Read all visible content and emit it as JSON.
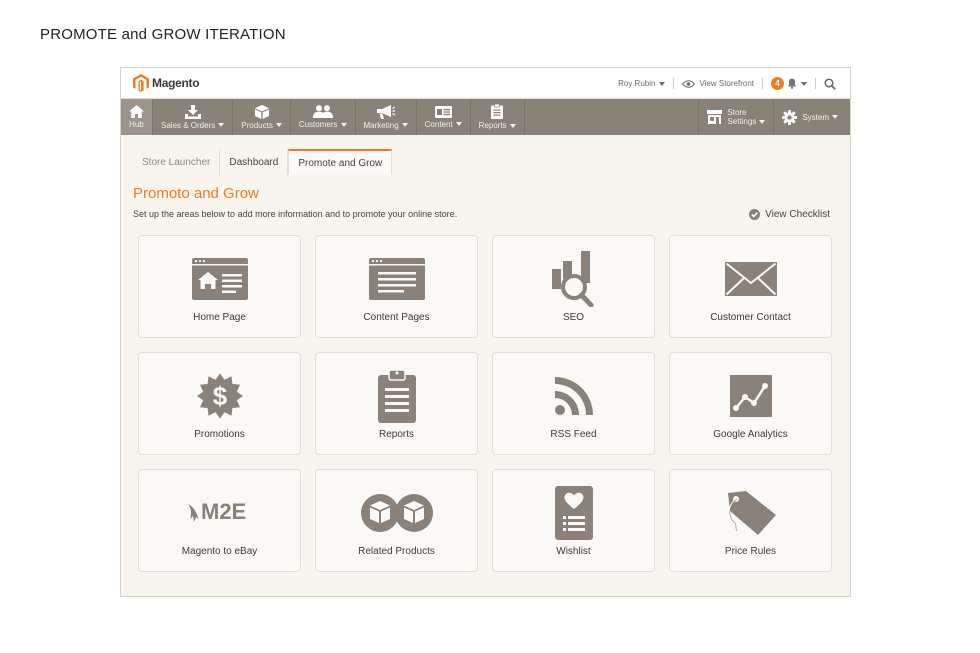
{
  "caption": "PROMOTE and GROW ITERATION",
  "brand": {
    "logo_text": "Magento",
    "accent": "#ef7c22",
    "nav_bg": "#8a8279",
    "icon_color": "#8a8279"
  },
  "topbar": {
    "user": "Roy Rubin",
    "storefront": "View Storefront",
    "notifications": "4"
  },
  "nav": {
    "items": [
      {
        "label": "Hub",
        "icon": "home-icon"
      },
      {
        "label": "Sales & Orders",
        "icon": "download-tray-icon"
      },
      {
        "label": "Products",
        "icon": "box-icon"
      },
      {
        "label": "Customers",
        "icon": "people-icon"
      },
      {
        "label": "Marketing",
        "icon": "megaphone-icon"
      },
      {
        "label": "Content",
        "icon": "page-layout-icon"
      },
      {
        "label": "Reports",
        "icon": "clipboard-icon"
      }
    ],
    "store_settings_line1": "Store",
    "store_settings_line2": "Settings",
    "system": "System"
  },
  "tabs": [
    "Store Launcher",
    "Dashboard",
    "Promote and Grow"
  ],
  "page": {
    "title": "Promoto and Grow",
    "subtitle": "Set up the areas below to add more information and to promote your online store.",
    "checklist": "View Checklist"
  },
  "cards": [
    {
      "label": "Home Page",
      "icon": "home-page-icon"
    },
    {
      "label": "Content Pages",
      "icon": "content-pages-icon"
    },
    {
      "label": "SEO",
      "icon": "seo-icon"
    },
    {
      "label": "Customer Contact",
      "icon": "envelope-icon"
    },
    {
      "label": "Promotions",
      "icon": "dollar-badge-icon"
    },
    {
      "label": "Reports",
      "icon": "clipboard-icon"
    },
    {
      "label": "RSS Feed",
      "icon": "rss-icon"
    },
    {
      "label": "Google Analytics",
      "icon": "analytics-chart-icon"
    },
    {
      "label": "Magento to eBay",
      "icon": "m2e-logo-icon",
      "logo_text": "M2E"
    },
    {
      "label": "Related Products",
      "icon": "two-boxes-icon"
    },
    {
      "label": "Wishlist",
      "icon": "wishlist-icon"
    },
    {
      "label": "Price Rules",
      "icon": "price-tag-icon"
    }
  ]
}
